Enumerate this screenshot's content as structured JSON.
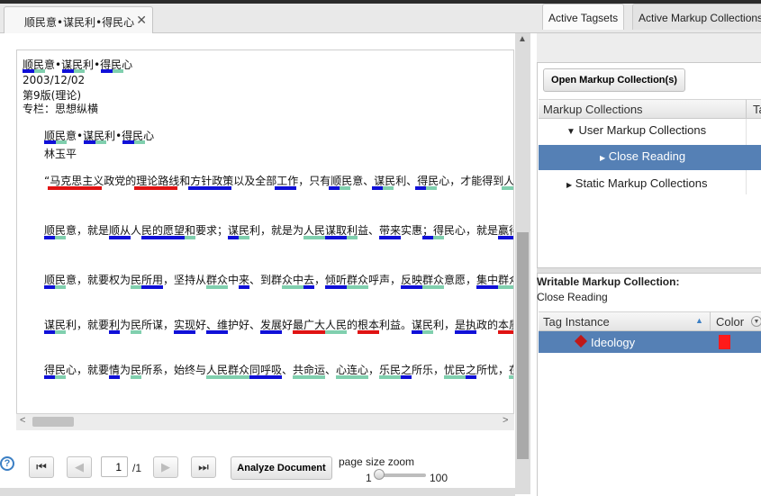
{
  "tab": {
    "title": "顺民意•谋民利•得民心",
    "close": "✕"
  },
  "document": {
    "title": "顺民意•谋民利•得民心",
    "date": "2003/12/02",
    "edition": "第9版(理论)",
    "column": "专栏：思想纵横",
    "heading": "顺民意•谋民利•得民心",
    "author": "林玉平",
    "paragraphs": [
      "“马克思主义政党的理论路线和方针政策以及全部工作，只有顺民意、谋民利、得民心，才能得到人",
      "顺民意，就是顺从人民的愿望和要求；谋民利，就是为人民谋取利益、带来实惠；得民心，就是赢得",
      "顺民意，就要权为民所用，坚持从群众中来、到群众中去，倾听群众呼声，反映群众意愿，集中群众",
      "谋民利，就要利为民所谋，实现好、维护好、发展好最广大人民的根本利益。谋民利，是执政的本质",
      "得民心，就要情为民所系，始终与人民群众同呼吸、共命运、心连心，乐民之所乐，忧民之所忧，在"
    ]
  },
  "pager": {
    "first": "⏮",
    "prev": "◀",
    "page_value": "1",
    "page_total": "/1",
    "next": "▶",
    "last": "⏭",
    "analyze_label": "Analyze Document",
    "zoom_label": "page size zoom",
    "zoom_min": "1",
    "zoom_max": "100",
    "zoom_value_fraction": 0.05
  },
  "help_icon": "?",
  "right": {
    "tabs": [
      "Active Tagsets",
      "Active Markup Collections"
    ],
    "open_button": "Open Markup Collection(s)",
    "collections_header": "Markup Collections",
    "collections_header2": "Ta",
    "tree": [
      {
        "arrow": "▼",
        "label": "User Markup Collections"
      },
      {
        "arrow": "▶",
        "label": "Close Reading"
      },
      {
        "arrow": "▶",
        "label": "Static Markup Collections"
      }
    ],
    "writable_label": "Writable Markup Collection:",
    "writable_value": "Close Reading",
    "instance_header": "Tag Instance",
    "sort_arrow": "▲",
    "color_header": "Color",
    "instance": {
      "label": "Ideology",
      "color": "#ff1a1a"
    }
  },
  "colors": {
    "markup_blue": "#1010d8",
    "markup_teal": "#80cfae",
    "markup_red": "#e01313",
    "selection": "#5580b5"
  }
}
